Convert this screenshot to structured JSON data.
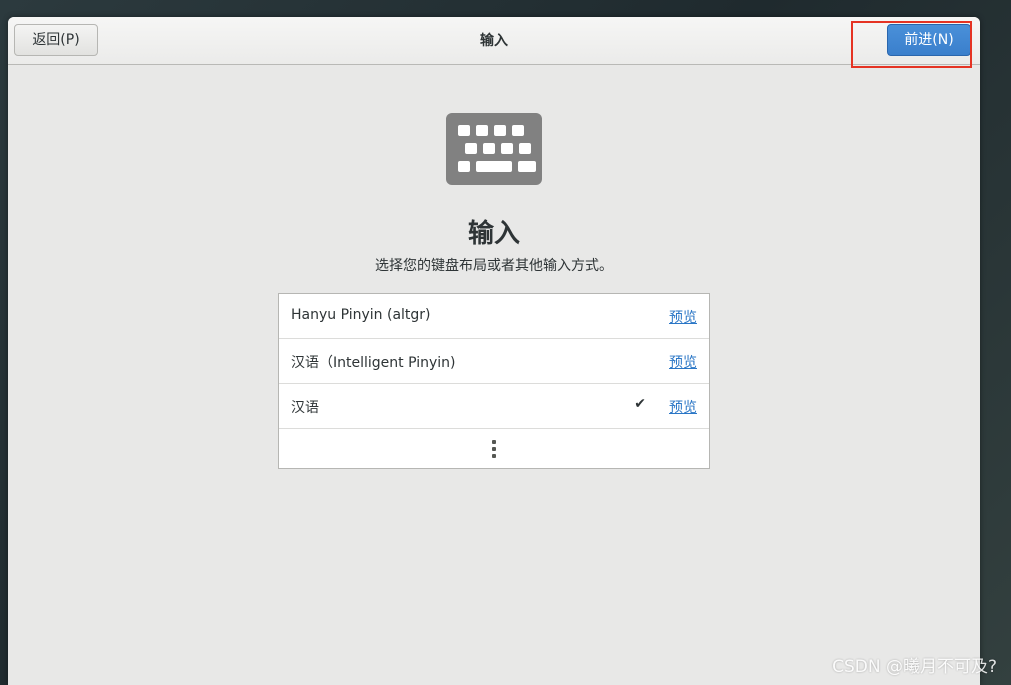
{
  "header": {
    "back_label": "返回(P)",
    "title": "输入",
    "forward_label": "前进(N)"
  },
  "page": {
    "icon": "keyboard-icon",
    "heading": "输入",
    "description": "选择您的键盘布局或者其他输入方式。"
  },
  "input_sources": [
    {
      "label": "Hanyu Pinyin (altgr)",
      "preview_label": "预览",
      "selected": false
    },
    {
      "label": "汉语（Intelligent Pinyin)",
      "preview_label": "预览",
      "selected": false
    },
    {
      "label": "汉语",
      "preview_label": "预览",
      "selected": true,
      "check": "✔"
    }
  ],
  "more_icon": "more-vertical-icon",
  "watermark": "CSDN @曦月不可及?",
  "colors": {
    "accent": "#3a7fcc",
    "link": "#2a76c6",
    "highlight": "#e53323"
  }
}
